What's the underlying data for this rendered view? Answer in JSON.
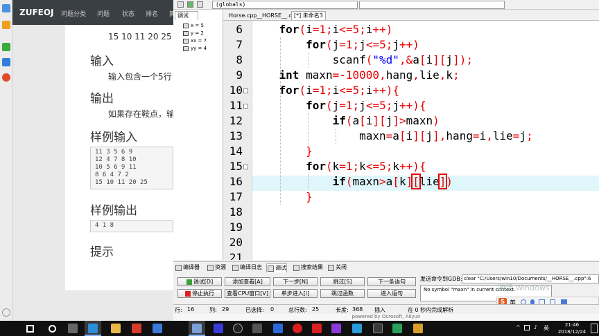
{
  "browser": {
    "brand": "ZUFEOJ",
    "nav": [
      "问题分类",
      "问题",
      "状态",
      "排名",
      "算"
    ],
    "line_top": "15 10 11 20 25",
    "input_heading": "输入",
    "input_text": "输入包含一个5行",
    "output_heading": "输出",
    "output_text": "如果存在鞍点，输",
    "sample_input_heading": "样例输入",
    "sample_input_lines": [
      "11 3 5 6 9",
      "12 4 7 8 10",
      "10 5 6 9 11",
      "8  6 4 7 2",
      "15 10 11 20 25"
    ],
    "sample_output_heading": "样例输出",
    "sample_output": "4 1 8",
    "hint_heading": "提示"
  },
  "ide": {
    "scope_combo": "(globals)",
    "debug_tab": "调试",
    "watches": [
      "x = 5",
      "y = 2",
      "xx = 7",
      "yy = 4"
    ],
    "file_tabs": [
      "Horse.cpp",
      "__HORSE__.cpp",
      "[*] 未命名3"
    ],
    "line_numbers": [
      "6",
      "7",
      "8",
      "9",
      "10",
      "11",
      "12",
      "13",
      "14",
      "15",
      "16",
      "17",
      "18",
      "19",
      "20",
      "21"
    ],
    "code_lines": [
      "    for(i=1;i<=5;i++)",
      "        for(j=1;j<=5;j++)",
      "            scanf(\"%d\",&a[i][j]);",
      "    int maxn=-10000,hang,lie,k;",
      "    for(i=1;i<=5;i++){",
      "        for(j=1;j<=5;j++){",
      "            if(a[i][j]>maxn)",
      "                maxn=a[i][j],hang=i,lie=j;",
      "        }",
      "        for(k=1;k<=5;k++){",
      "            if(maxn>a[k][lie])",
      "        }",
      "",
      "",
      "",
      ""
    ],
    "bottom_tabs": [
      "编译器",
      "资源",
      "编译日志",
      "调试",
      "搜索结果",
      "关闭"
    ],
    "buttons_row1": [
      "调试[D]",
      "添加查看[A]",
      "下一步[N]",
      "跳过[S]",
      "下一条语句"
    ],
    "buttons_row2": [
      "停止执行",
      "查看CPU窗口[V]",
      "单步进入[i]",
      "跳过函数",
      "进入语句"
    ],
    "gdb_label": "发送命令到GDB:",
    "gdb_command": "clear \"C:/Users/win10/Documents/__HORSE__.cpp\":6",
    "gdb_output": "No symbol \"maxn\" in current context.",
    "watermark": "激活 Windows",
    "status": {
      "row_label": "行:",
      "row": "16",
      "col_label": "列:",
      "col": "29",
      "sel_label": "已选择:",
      "sel": "0",
      "total_label": "总行数:",
      "total": "25",
      "len_label": "长度:",
      "len": "368",
      "mode": "插入",
      "parse": "在 0 秒内完成解析"
    },
    "powered": "powered by Ocrosoft, Aliyun"
  },
  "taskbar": {
    "time": "21:46",
    "date": "2018/12/24",
    "lang": "英",
    "ime": "S",
    "ime_lang": "英"
  },
  "colors": {
    "keyword": "#000000",
    "operator": "#e60000",
    "string": "#0000ff",
    "current_line": "#dff6fb",
    "taskbar": "#101010"
  }
}
